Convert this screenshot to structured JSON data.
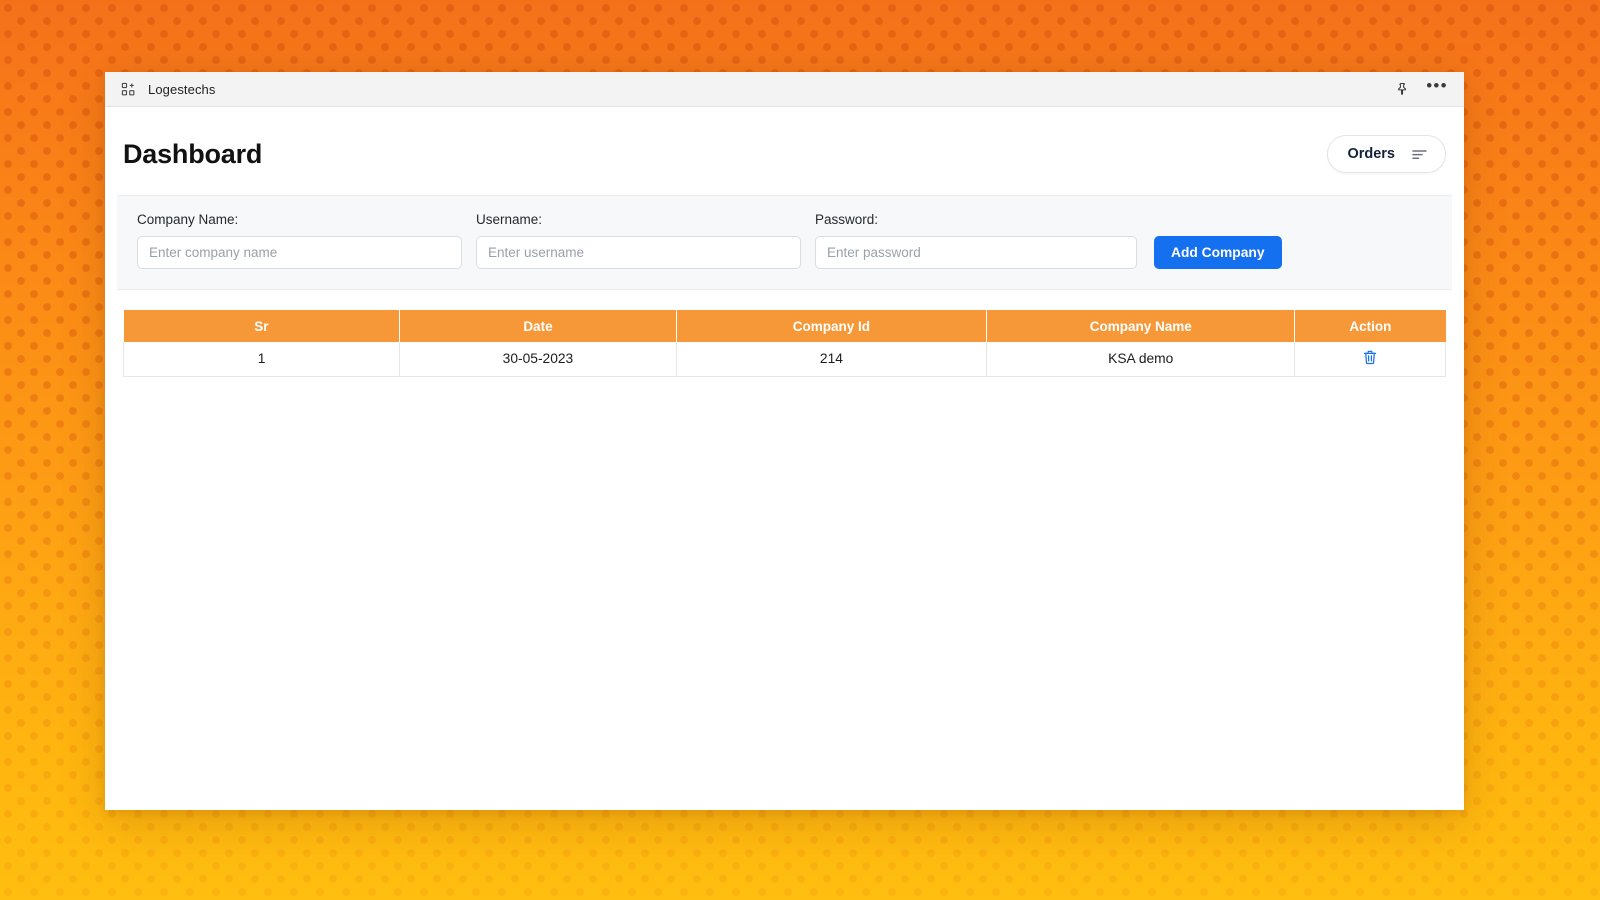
{
  "window": {
    "title": "Logestechs",
    "app_icon": "apps-grid-icon",
    "controls": {
      "pin_icon": "pin-icon",
      "pin_label": "Pin",
      "more_icon": "more-horizontal-icon",
      "more_label": "•••"
    }
  },
  "page": {
    "title": "Dashboard",
    "orders_button": {
      "label": "Orders",
      "icon": "filter-sort-icon"
    }
  },
  "form": {
    "fields": [
      {
        "name": "company-name",
        "label": "Company Name:",
        "placeholder": "Enter company name",
        "value": ""
      },
      {
        "name": "username",
        "label": "Username:",
        "placeholder": "Enter username",
        "value": ""
      },
      {
        "name": "password",
        "label": "Password:",
        "placeholder": "Enter password",
        "value": ""
      }
    ],
    "submit_label": "Add Company"
  },
  "table": {
    "columns": [
      "Sr",
      "Date",
      "Company Id",
      "Company Name",
      "Action"
    ],
    "rows": [
      {
        "sr": "1",
        "date": "30-05-2023",
        "company_id": "214",
        "company_name": "KSA demo",
        "action_icon": "trash-icon"
      }
    ]
  },
  "colors": {
    "table_header": "#F79838",
    "primary_button": "#1570EF",
    "trash_icon": "#1570EF",
    "desktop_gradient_top": "#F4711A",
    "desktop_gradient_bottom": "#FFBE10",
    "titlebar": "#F3F3F3",
    "form_strip": "#F7F8F9"
  }
}
